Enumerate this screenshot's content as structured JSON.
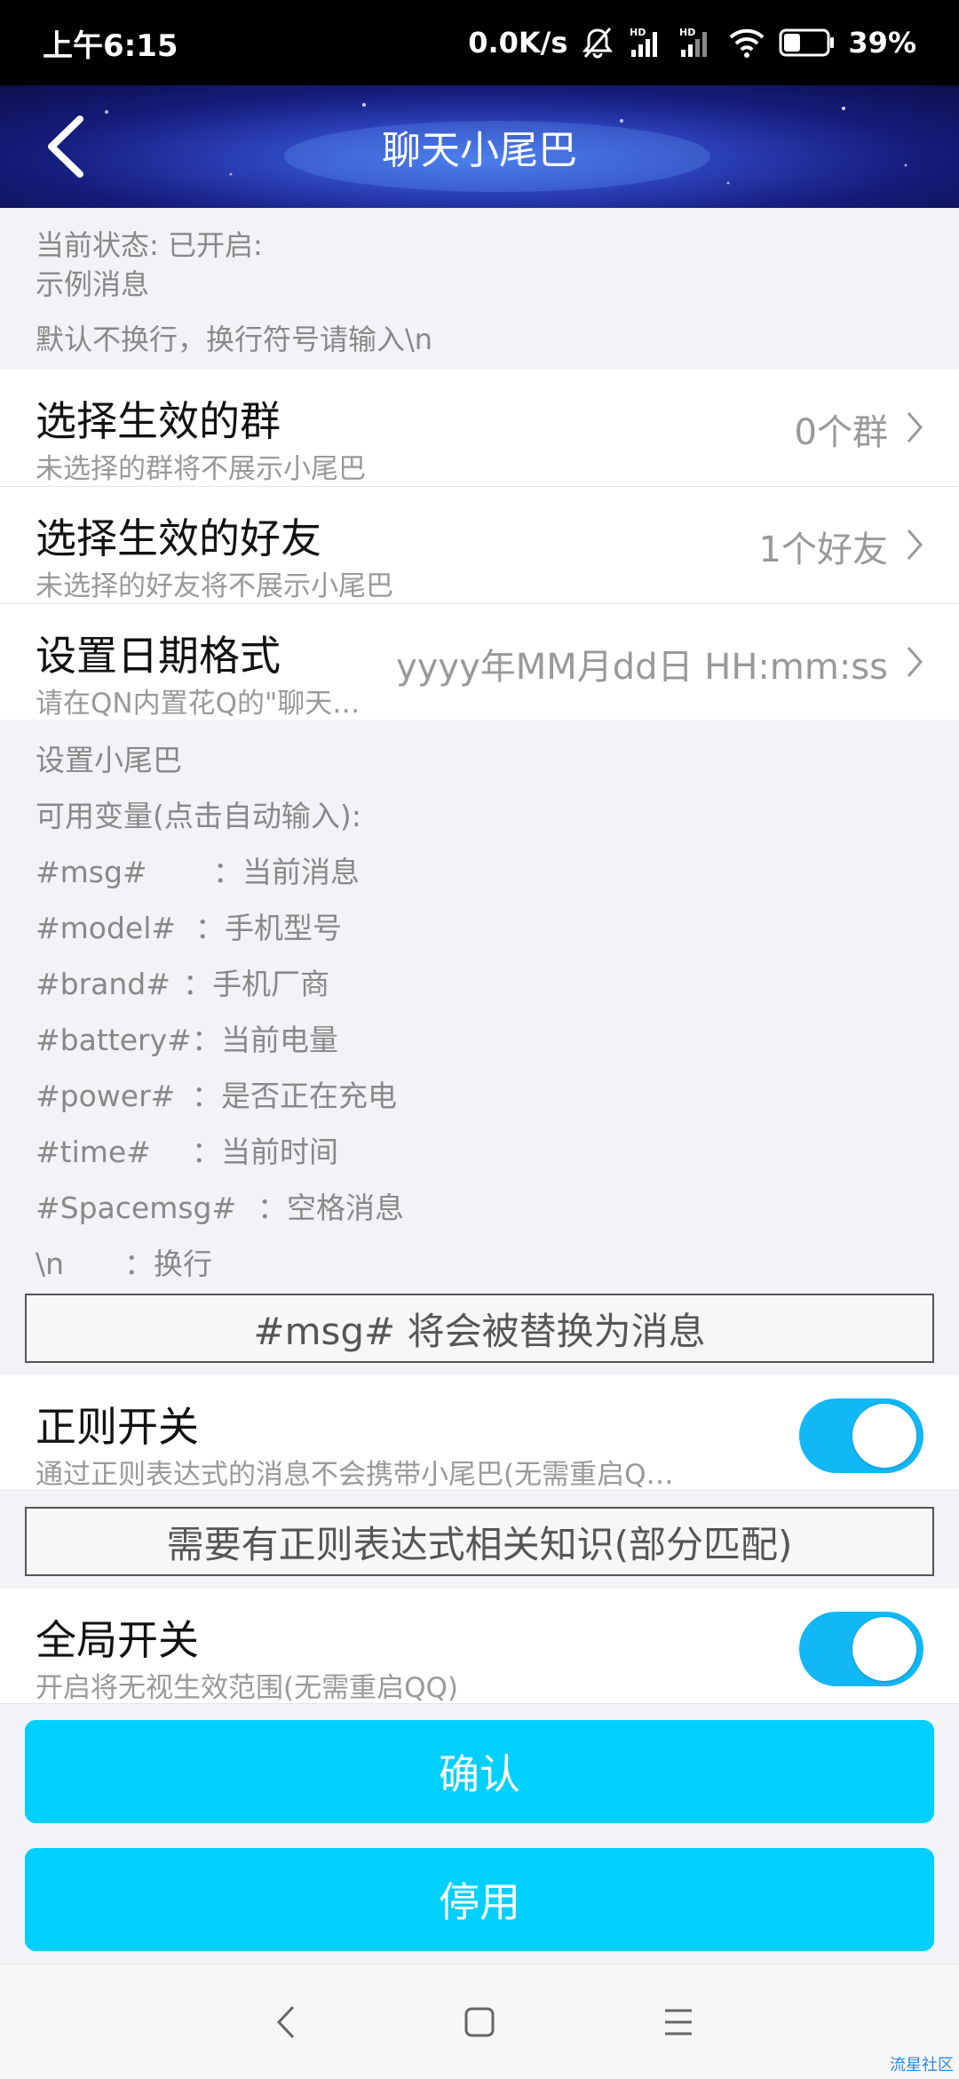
{
  "status_bar": {
    "time": "上午6:15",
    "network_speed": "0.0K/s",
    "battery_percent": "39%",
    "battery_level": 0.39
  },
  "header": {
    "title": "聊天小尾巴"
  },
  "info": {
    "status_line": "当前状态: 已开启:",
    "example_line": "示例消息",
    "hint_line": "默认不换行，换行符号请输入\\n"
  },
  "rows": {
    "groups": {
      "title": "选择生效的群",
      "subtitle": "未选择的群将不展示小尾巴",
      "value": "0个群"
    },
    "friends": {
      "title": "选择生效的好友",
      "subtitle": "未选择的好友将不展示小尾巴",
      "value": "1个好友"
    },
    "date_format": {
      "title": "设置日期格式",
      "subtitle": "请在QN内置花Q的\"聊天…",
      "value": "yyyy年MM月dd日 HH:mm:ss"
    }
  },
  "variables": {
    "heading": "设置小尾巴",
    "subheading": "可用变量(点击自动输入):",
    "items": [
      {
        "key": "#msg#",
        "desc": "：当前消息"
      },
      {
        "key": "#model#",
        "desc": "：手机型号"
      },
      {
        "key": "#brand#",
        "desc": "：手机厂商"
      },
      {
        "key": "#battery#",
        "desc": "：当前电量"
      },
      {
        "key": "#power#",
        "desc": "：是否正在充电"
      },
      {
        "key": "#time#",
        "desc": "：当前时间"
      },
      {
        "key": "#Spacemsg#",
        "desc": "：空格消息"
      },
      {
        "key": "\\n",
        "desc": "：换行"
      }
    ]
  },
  "tail_input": {
    "text": "#msg# 将会被替换为消息"
  },
  "regex": {
    "title": "正则开关",
    "subtitle": "通过正则表达式的消息不会携带小尾巴(无需重启Q…",
    "enabled": true,
    "input_text": "需要有正则表达式相关知识(部分匹配)"
  },
  "global": {
    "title": "全局开关",
    "subtitle": "开启将无视生效范围(无需重启QQ)",
    "enabled": true
  },
  "buttons": {
    "confirm": "确认",
    "disable": "停用"
  },
  "watermark": "流星社区",
  "colors": {
    "accent": "#00d0ff",
    "toggle_on": "#12b7f5"
  }
}
